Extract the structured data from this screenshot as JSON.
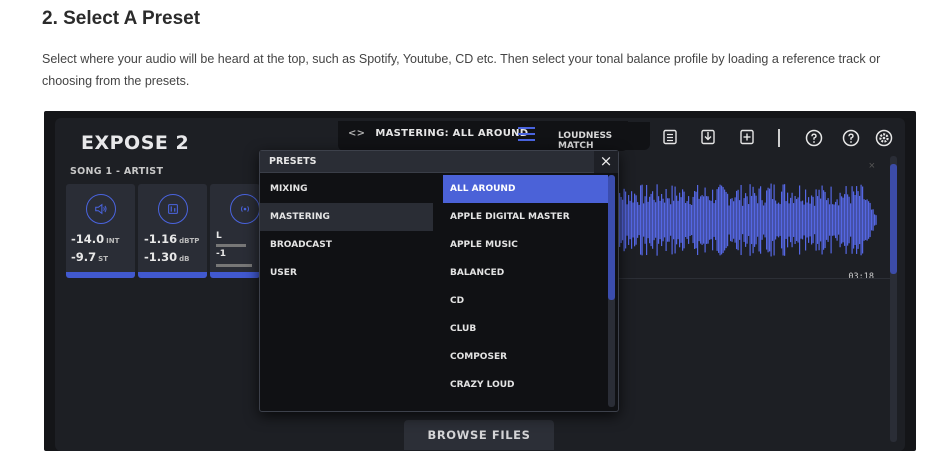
{
  "article": {
    "title": "2. Select A Preset",
    "body": "Select where your audio will be heard at the top, such as Spotify, Youtube, CD etc. Then select your tonal balance profile by loading a reference track or choosing from the presets."
  },
  "app": {
    "title": "EXPOSE 2",
    "mastering_label": "MASTERING: ALL AROUND",
    "loudness_match_label": "LOUDNESS MATCH",
    "song_title": "SONG 1 - ARTIST",
    "meters": [
      {
        "value": "-14.0",
        "unit": "INT",
        "value2": "-9.7",
        "unit2": "ST"
      },
      {
        "value": "-1.16",
        "unit": "dBTP",
        "value2": "-1.30",
        "unit2": "dB"
      }
    ],
    "stereo_labels": {
      "l": "L",
      "val": "-1"
    },
    "time": "03:18",
    "browse_files": "BROWSE FILES",
    "accent_color": "#4b62d8"
  },
  "presets_popup": {
    "title": "PRESETS",
    "close": "×",
    "categories": [
      "MIXING",
      "MASTERING",
      "BROADCAST",
      "USER"
    ],
    "active_category": "MASTERING",
    "items": [
      "ALL AROUND",
      "APPLE DIGITAL MASTER",
      "APPLE MUSIC",
      "BALANCED",
      "CD",
      "CLUB",
      "COMPOSER",
      "CRAZY LOUD"
    ],
    "selected_item": "ALL AROUND"
  },
  "icons": [
    "chevron-left-right-icon",
    "hamburger-menu-icon",
    "list-icon",
    "download-icon",
    "add-icon",
    "help-icon",
    "question-icon",
    "gear-icon",
    "speaker-icon",
    "meter-icon",
    "stereo-icon"
  ]
}
